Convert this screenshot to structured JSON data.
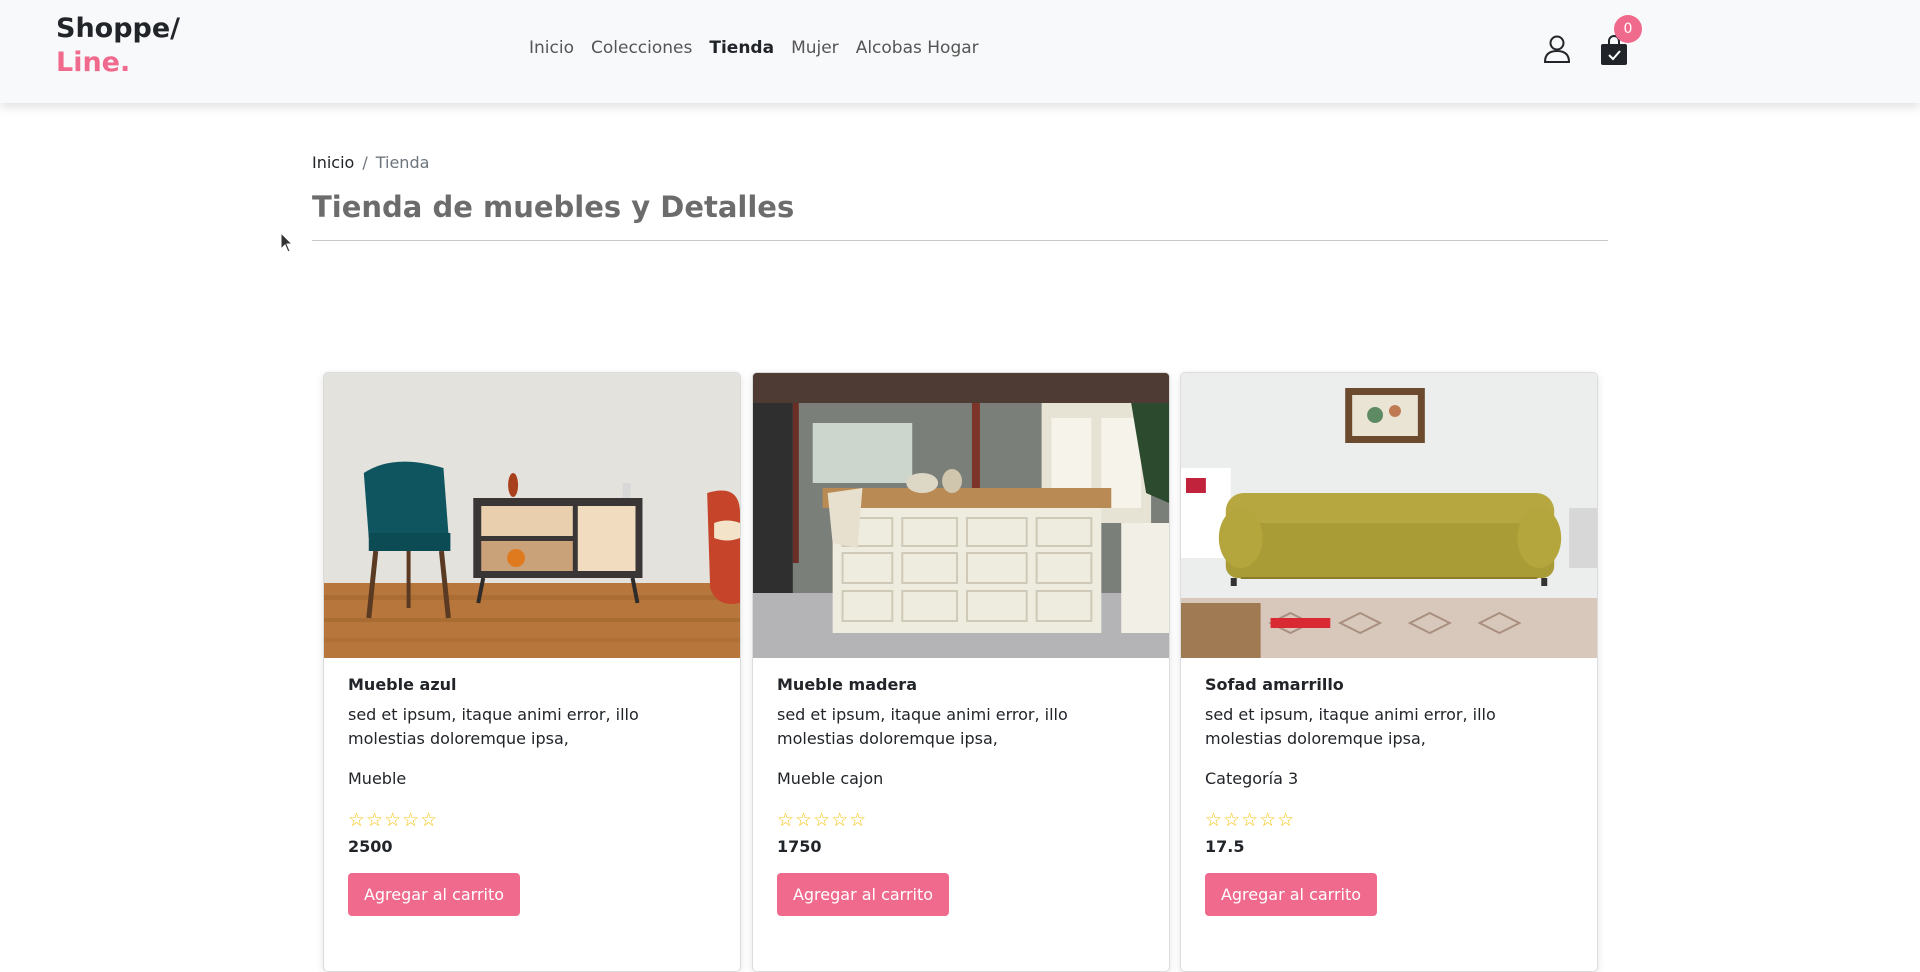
{
  "brand": {
    "line1": "Shoppe/",
    "line2": "Line."
  },
  "nav": {
    "items": [
      {
        "label": "Inicio"
      },
      {
        "label": "Colecciones"
      },
      {
        "label": "Tienda"
      },
      {
        "label": "Mujer"
      },
      {
        "label": "Alcobas Hogar"
      }
    ],
    "active": "Tienda"
  },
  "header": {
    "cart_count": "0",
    "icons": [
      "user-icon",
      "shopping-bag-icon"
    ]
  },
  "breadcrumb": {
    "home": "Inicio",
    "separator": "/",
    "current": "Tienda"
  },
  "page": {
    "title": "Tienda de muebles y Detalles"
  },
  "colors": {
    "accent": "#f06a8d",
    "star": "#f5c518",
    "navbar_bg": "#f8f9fa"
  },
  "products": [
    {
      "name": "Mueble azul",
      "description": "sed et ipsum, itaque animi error, illo molestias doloremque ipsa,",
      "category": "Mueble",
      "rating_display": "☆☆☆☆☆",
      "rating": 0,
      "price": "2500",
      "button": "Agregar al carrito"
    },
    {
      "name": "Mueble madera",
      "description": "sed et ipsum, itaque animi error, illo molestias doloremque ipsa,",
      "category": "Mueble cajon",
      "rating_display": "☆☆☆☆☆",
      "rating": 0,
      "price": "1750",
      "button": "Agregar al carrito"
    },
    {
      "name": "Sofad amarrillo",
      "description": "sed et ipsum, itaque animi error, illo molestias doloremque ipsa,",
      "category": "Categoría 3",
      "rating_display": "☆☆☆☆☆",
      "rating": 0,
      "price": "17.5",
      "button": "Agregar al carrito"
    }
  ]
}
